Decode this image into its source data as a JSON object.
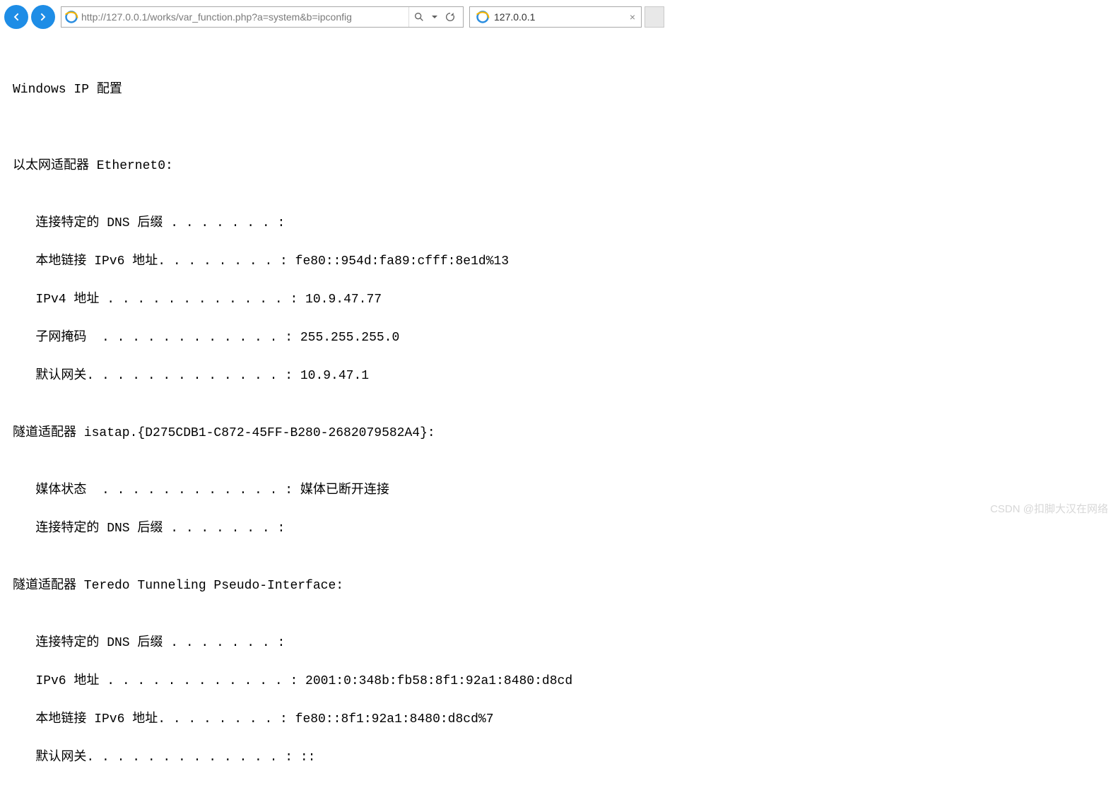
{
  "toolbar": {
    "url": "http://127.0.0.1/works/var_function.php?a=system&b=ipconfig",
    "tab_title": "127.0.0.1"
  },
  "page": {
    "blank1": "",
    "header": "Windows IP 配置",
    "blank2": "",
    "blank3": "",
    "eth_header": "以太网适配器 Ethernet0:",
    "blank4": "",
    "eth_dns": "   连接特定的 DNS 后缀 . . . . . . . :",
    "eth_ipv6": "   本地链接 IPv6 地址. . . . . . . . : fe80::954d:fa89:cfff:8e1d%13",
    "eth_ipv4": "   IPv4 地址 . . . . . . . . . . . . : 10.9.47.77",
    "eth_mask": "   子网掩码  . . . . . . . . . . . . : 255.255.255.0",
    "eth_gw": "   默认网关. . . . . . . . . . . . . : 10.9.47.1",
    "blank5": "",
    "isatap_header": "隧道适配器 isatap.{D275CDB1-C872-45FF-B280-2682079582A4}:",
    "blank6": "",
    "isatap_media": "   媒体状态  . . . . . . . . . . . . : 媒体已断开连接",
    "isatap_dns": "   连接特定的 DNS 后缀 . . . . . . . :",
    "blank7": "",
    "teredo_header": "隧道适配器 Teredo Tunneling Pseudo-Interface:",
    "blank8": "",
    "teredo_dns": "   连接特定的 DNS 后缀 . . . . . . . :",
    "teredo_ipv6": "   IPv6 地址 . . . . . . . . . . . . : 2001:0:348b:fb58:8f1:92a1:8480:d8cd",
    "teredo_llv6": "   本地链接 IPv6 地址. . . . . . . . : fe80::8f1:92a1:8480:d8cd%7",
    "teredo_gw": "   默认网关. . . . . . . . . . . . . : ::"
  },
  "watermark": "CSDN @扣脚大汉在网络"
}
